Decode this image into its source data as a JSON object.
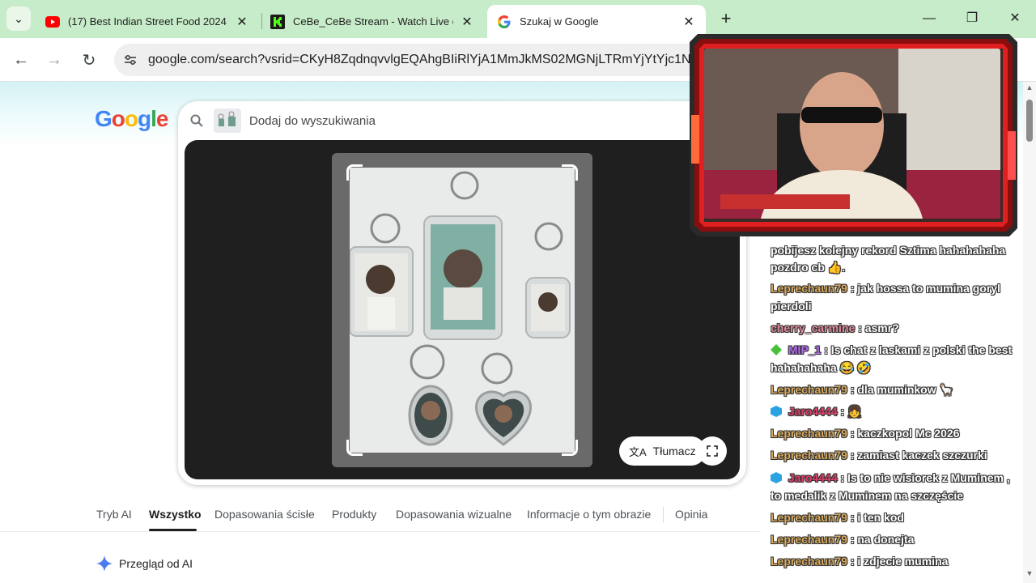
{
  "browser": {
    "tabs": [
      {
        "title": "(17) Best Indian Street Food 2024 |",
        "favicon": "youtube-icon"
      },
      {
        "title": "CeBe_CeBe Stream - Watch Live on",
        "favicon": "kick-icon"
      },
      {
        "title": "Szukaj w Google",
        "favicon": "google-icon",
        "active": true
      }
    ],
    "new_tab": "+",
    "url": "google.com/search?vsrid=CKyH8ZqdnqvvlgEQAhgBIiRlYjA1MmJkMS02MGNjLTRmYjYtYjc1NS"
  },
  "google": {
    "logo": "Google",
    "search_placeholder": "Dodaj do wyszukiwania",
    "translate_label": "Tłumacz",
    "filters": [
      "Tryb AI",
      "Wszystko",
      "Dopasowania ścisłe",
      "Produkty",
      "Dopasowania wizualne",
      "Informacje o tym obrazie",
      "Opinia"
    ],
    "active_filter": "Wszystko",
    "ai_overview": "Przegląd od AI"
  },
  "chat": [
    {
      "user": "",
      "text": "pobijesz kolejny rekord Sztima hahahahaha",
      "partial": true
    },
    {
      "user": "",
      "text": "pozdro cb 👍.",
      "partial": false
    },
    {
      "user": "Leprechaun79",
      "text": ": jak hossa to mumina goryl pierdoli",
      "color": "#d8a95a"
    },
    {
      "user": "cherry_carmine",
      "text": ": asmr?",
      "color": "#e28a9c"
    },
    {
      "user": "MIP_1",
      "text": ": Is chat z laskami z polski the best hahahahaha 😂 🤣",
      "color": "#b36cf0",
      "badge": "green-diamond-icon"
    },
    {
      "user": "Leprechaun79",
      "text": ": dla muminkow 🦙",
      "color": "#d8a95a"
    },
    {
      "user": "Jaro4444",
      "text": ": 👧",
      "color": "#e0406b",
      "badge": "blue-cube-icon"
    },
    {
      "user": "Leprechaun79",
      "text": ": kaczkopol Mc 2026",
      "color": "#d8a95a"
    },
    {
      "user": "Leprechaun79",
      "text": ": zamiast kaczek szczurki",
      "color": "#d8a95a"
    },
    {
      "user": "Jaro4444",
      "text": ": Is to nie wisiorek z Muminem , to medalik z Muminem na szczęście",
      "color": "#e0406b",
      "badge": "blue-cube-icon"
    },
    {
      "user": "Leprechaun79",
      "text": ": i ten kod",
      "color": "#d8a95a"
    },
    {
      "user": "Leprechaun79",
      "text": ": na donejta",
      "color": "#d8a95a"
    },
    {
      "user": "Leprechaun79",
      "text": ": i zdjecie mumina",
      "color": "#d8a95a"
    }
  ],
  "colors": {
    "tabstrip": "#c7ecc9",
    "google_blue": "#4285f4",
    "google_red": "#ea4335",
    "google_yellow": "#fbbc05",
    "google_green": "#34a853",
    "overlay_red": "#e02020"
  }
}
